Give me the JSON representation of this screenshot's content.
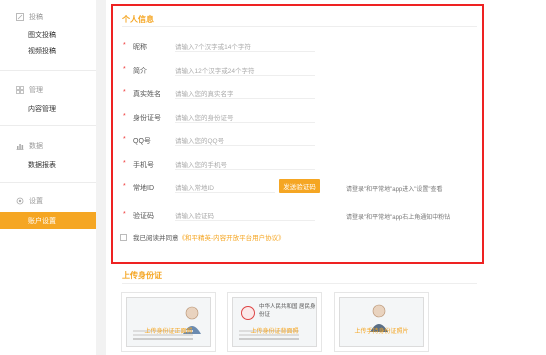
{
  "sidebar": {
    "groups": [
      {
        "title": "投稿",
        "icon": "edit-icon",
        "items": [
          "图文投稿",
          "视频投稿"
        ]
      },
      {
        "title": "管理",
        "icon": "grid-icon",
        "items": [
          "内容管理"
        ]
      },
      {
        "title": "数据",
        "icon": "chart-icon",
        "items": [
          "数据报表"
        ]
      },
      {
        "title": "设置",
        "icon": "gear-icon",
        "items": [
          "账户设置"
        ]
      }
    ],
    "active_item": "账户设置"
  },
  "profile": {
    "title": "个人信息",
    "fields": [
      {
        "label": "昵称",
        "placeholder": "请输入7个汉字或14个字符",
        "note": ""
      },
      {
        "label": "简介",
        "placeholder": "请输入12个汉字或24个字符",
        "note": ""
      },
      {
        "label": "真实姓名",
        "placeholder": "请输入您的真实名字",
        "note": ""
      },
      {
        "label": "身份证号",
        "placeholder": "请输入您的身份证号",
        "note": ""
      },
      {
        "label": "QQ号",
        "placeholder": "请输入您的QQ号",
        "note": ""
      },
      {
        "label": "手机号",
        "placeholder": "请输入您的手机号",
        "note": ""
      },
      {
        "label": "常地ID",
        "placeholder": "请输入常地ID",
        "note": "请登录\"和平常地\"app进入\"设置\"查看"
      },
      {
        "label": "验证码",
        "placeholder": "请输入验证码",
        "note": "请登录\"和平常地\"app右上角通知中粉钻"
      }
    ],
    "send_code_label": "发送验证码",
    "agree_text": "我已阅读并同意",
    "agree_link": "《和平精英-内容开放平台用户协议》"
  },
  "upload": {
    "title": "上传身份证",
    "cards": [
      {
        "caption": "上传身份证正面照",
        "header": ""
      },
      {
        "caption": "上传身份证背面照",
        "header": "中华人民共和国 居民身份证"
      },
      {
        "caption": "上传手持身份证照片",
        "header": ""
      }
    ]
  },
  "colors": {
    "accent": "#f5a623",
    "highlight_frame": "#e22222",
    "required_star": "#e33333"
  }
}
